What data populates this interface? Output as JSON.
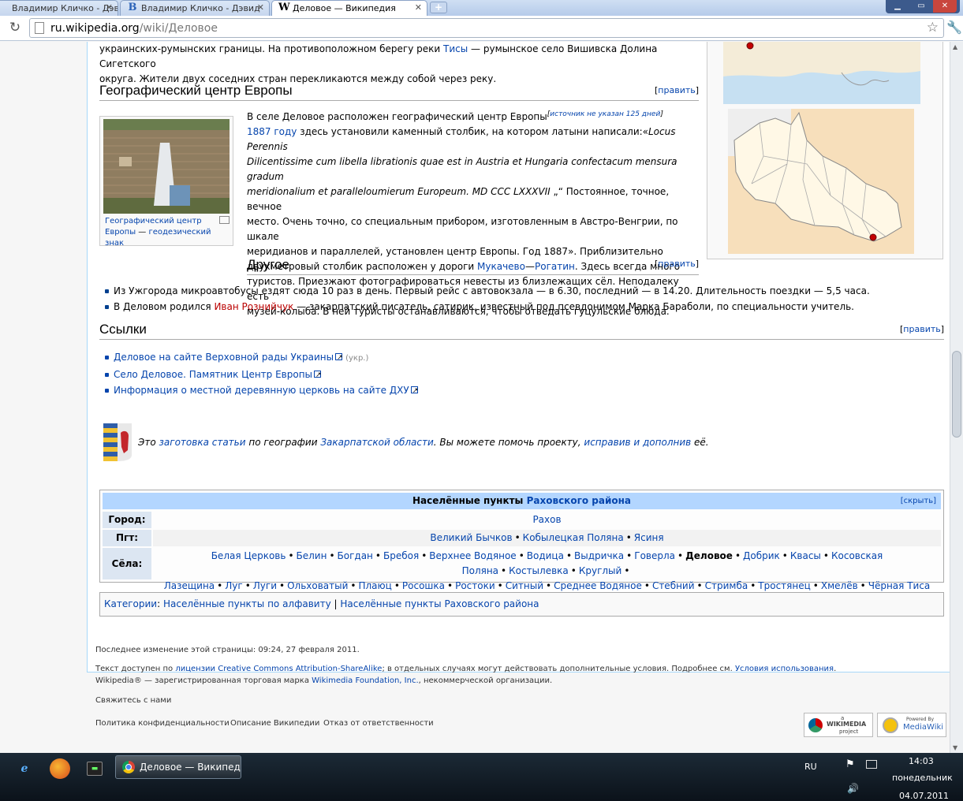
{
  "browser": {
    "tabs": [
      {
        "title": "Владимир Кличко - Дэвид",
        "favicon": "letter-B"
      },
      {
        "title": "Владимир Кличко - Дэвид",
        "favicon": "letter-B"
      },
      {
        "title": "Деловое — Википедия",
        "favicon": "wikipedia-W",
        "active": true
      }
    ],
    "url_host": "ru.wikipedia.org",
    "url_path": "/wiki/Деловое"
  },
  "article": {
    "intro_line1_a": "украинских-румынских границы. На противоположном берегу реки ",
    "intro_link_tisa": "Тисы",
    "intro_line1_b": " — румынское село Вишивска Долина Сигетского",
    "intro_line2": "округа. Жители двух соседних стран перекликаются между собой через реку.",
    "edit_label": "править",
    "sections": {
      "geo_center": {
        "title": "Географический центр Европы",
        "p_start": "В селе Деловое расположен географический центр Европы",
        "citation_needed": "источник не указан 125 дней",
        "year_link": "1887 году",
        "p_text1": " здесь установили каменный столбик, на котором латыни написали:«",
        "latin1": "Locus Perennis",
        "latin2": "Dilicentissime cum libella librationis quae est in Austria et Hungaria confectacum mensura gradum",
        "latin3": "meridionalium et paralleloumierum Europeum. MD CCC LXXXVII",
        "p_text2": " „“ Постоянное, точное, вечное",
        "line5": "место. Очень точно, со специальным прибором, изготовленным в Австро-Венгрии, по шкале",
        "line6": "меридианов и параллелей, установлен центр Европы. Год 1887». Приблизительно",
        "line7_a": "двухметровый столбик расположен у дороги ",
        "link_mukachevo": "Мукачево",
        "dash": "—",
        "link_rogatin": "Рогатин",
        "line7_b": ". Здесь всегда много",
        "line8": "туристов. Приезжают фотографироваться невесты из близлежащих сёл. Неподалеку есть",
        "line9": "музей-колыба. В ней туристы останавливаются, чтобы отведать гуцульские блюда.",
        "thumb_caption_a": "Географический центр Европы",
        "thumb_caption_sep": " — ",
        "thumb_caption_b": "геодезический знак"
      },
      "other": {
        "title": "Другое",
        "item1": "Из Ужгорода микроавтобусы ездят сюда 10 раз в день. Первый рейс с автовокзала — в 6.30, последний — в 14.20. Длительность поездки — 5,5 часа.",
        "item2_a": "В Деловом родился ",
        "item2_link": "Иван Рознийчук",
        "item2_b": " — закарпатский писатель, сатирик, известный под псевдонимом Марка Бараболи, по специальности учитель."
      },
      "links": {
        "title": "Ссылки",
        "items": [
          {
            "text": "Деловое на сайте Верховной рады Украины",
            "lang": "(укр.)"
          },
          {
            "text": "Село Деловое. Памятник Центр Европы"
          },
          {
            "text": "Информация о местной деревянную церковь на сайте ДХУ"
          }
        ]
      }
    },
    "stub": {
      "a": "Это ",
      "link1": "заготовка статьи",
      "b": " по географии ",
      "link2": "Закарпатской области",
      "c": ". Вы можете помочь проекту, ",
      "link3": "исправив и дополнив",
      "d": " её."
    },
    "navbox": {
      "title_a": "Населённые пункты ",
      "title_link": "Раховского района",
      "hide": "[скрыть]",
      "rows": [
        {
          "group": "Город:",
          "items": [
            "Рахов"
          ]
        },
        {
          "group": "Пгт:",
          "items": [
            "Великий Бычков",
            "Кобылецкая Поляна",
            "Ясиня"
          ]
        },
        {
          "group": "Сёла:",
          "items_line1": [
            "Белая Церковь",
            "Белин",
            "Богдан",
            "Бребоя",
            "Верхнее Водяное",
            "Водица",
            "Выдричка",
            "Говерла",
            "Деловое",
            "Добрик",
            "Квасы",
            "Косовская Поляна",
            "Костылевка",
            "Круглый"
          ],
          "items_line2": [
            "Лазещина",
            "Луг",
            "Луги",
            "Ольховатый",
            "Плаюц",
            "Росошка",
            "Ростоки",
            "Ситный",
            "Среднее Водяное",
            "Стебний",
            "Стримба",
            "Тростянец",
            "Хмелёв",
            "Чёрная Тиса"
          ]
        }
      ]
    },
    "categories": {
      "label": "Категории",
      "colon": ": ",
      "cat1": "Населённые пункты по алфавиту",
      "sep": " | ",
      "cat2": "Населённые пункты Раховского района"
    }
  },
  "footer": {
    "lastmod": "Последнее изменение этой страницы: 09:24, 27 февраля 2011.",
    "license_a": "Текст доступен по ",
    "license_link": "лицензии Creative Commons Attribution-ShareAlike",
    "license_b": "; в отдельных случаях могут действовать дополнительные условия. Подробнее см. ",
    "terms_link": "Условия использования",
    "license_c": ".",
    "tm_a": "Wikipedia® — зарегистрированная торговая марка ",
    "tm_link": "Wikimedia Foundation, Inc.",
    "tm_b": ", некоммерческой организации.",
    "contact": "Свяжитесь с нами",
    "privacy": "Политика конфиденциальности",
    "about": "Описание Википедии",
    "disclaimer": "Отказ от ответственности",
    "wm_badge_a": "a",
    "wm_badge_b": "WIKIMEDIA",
    "wm_badge_c": "project",
    "mw_badge_a": "Powered By",
    "mw_badge_b": "MediaWiki"
  },
  "taskbar": {
    "task_title": "Деловое — Википед...",
    "lang": "RU",
    "time": "14:03",
    "day": "понедельник",
    "date": "04.07.2011"
  },
  "colors": {
    "link": "#0645ad",
    "redlink": "#ba0000",
    "content_border": "#a7d7f9",
    "navbox_header": "#b3d6ff",
    "navbox_group": "#dce6f2"
  }
}
